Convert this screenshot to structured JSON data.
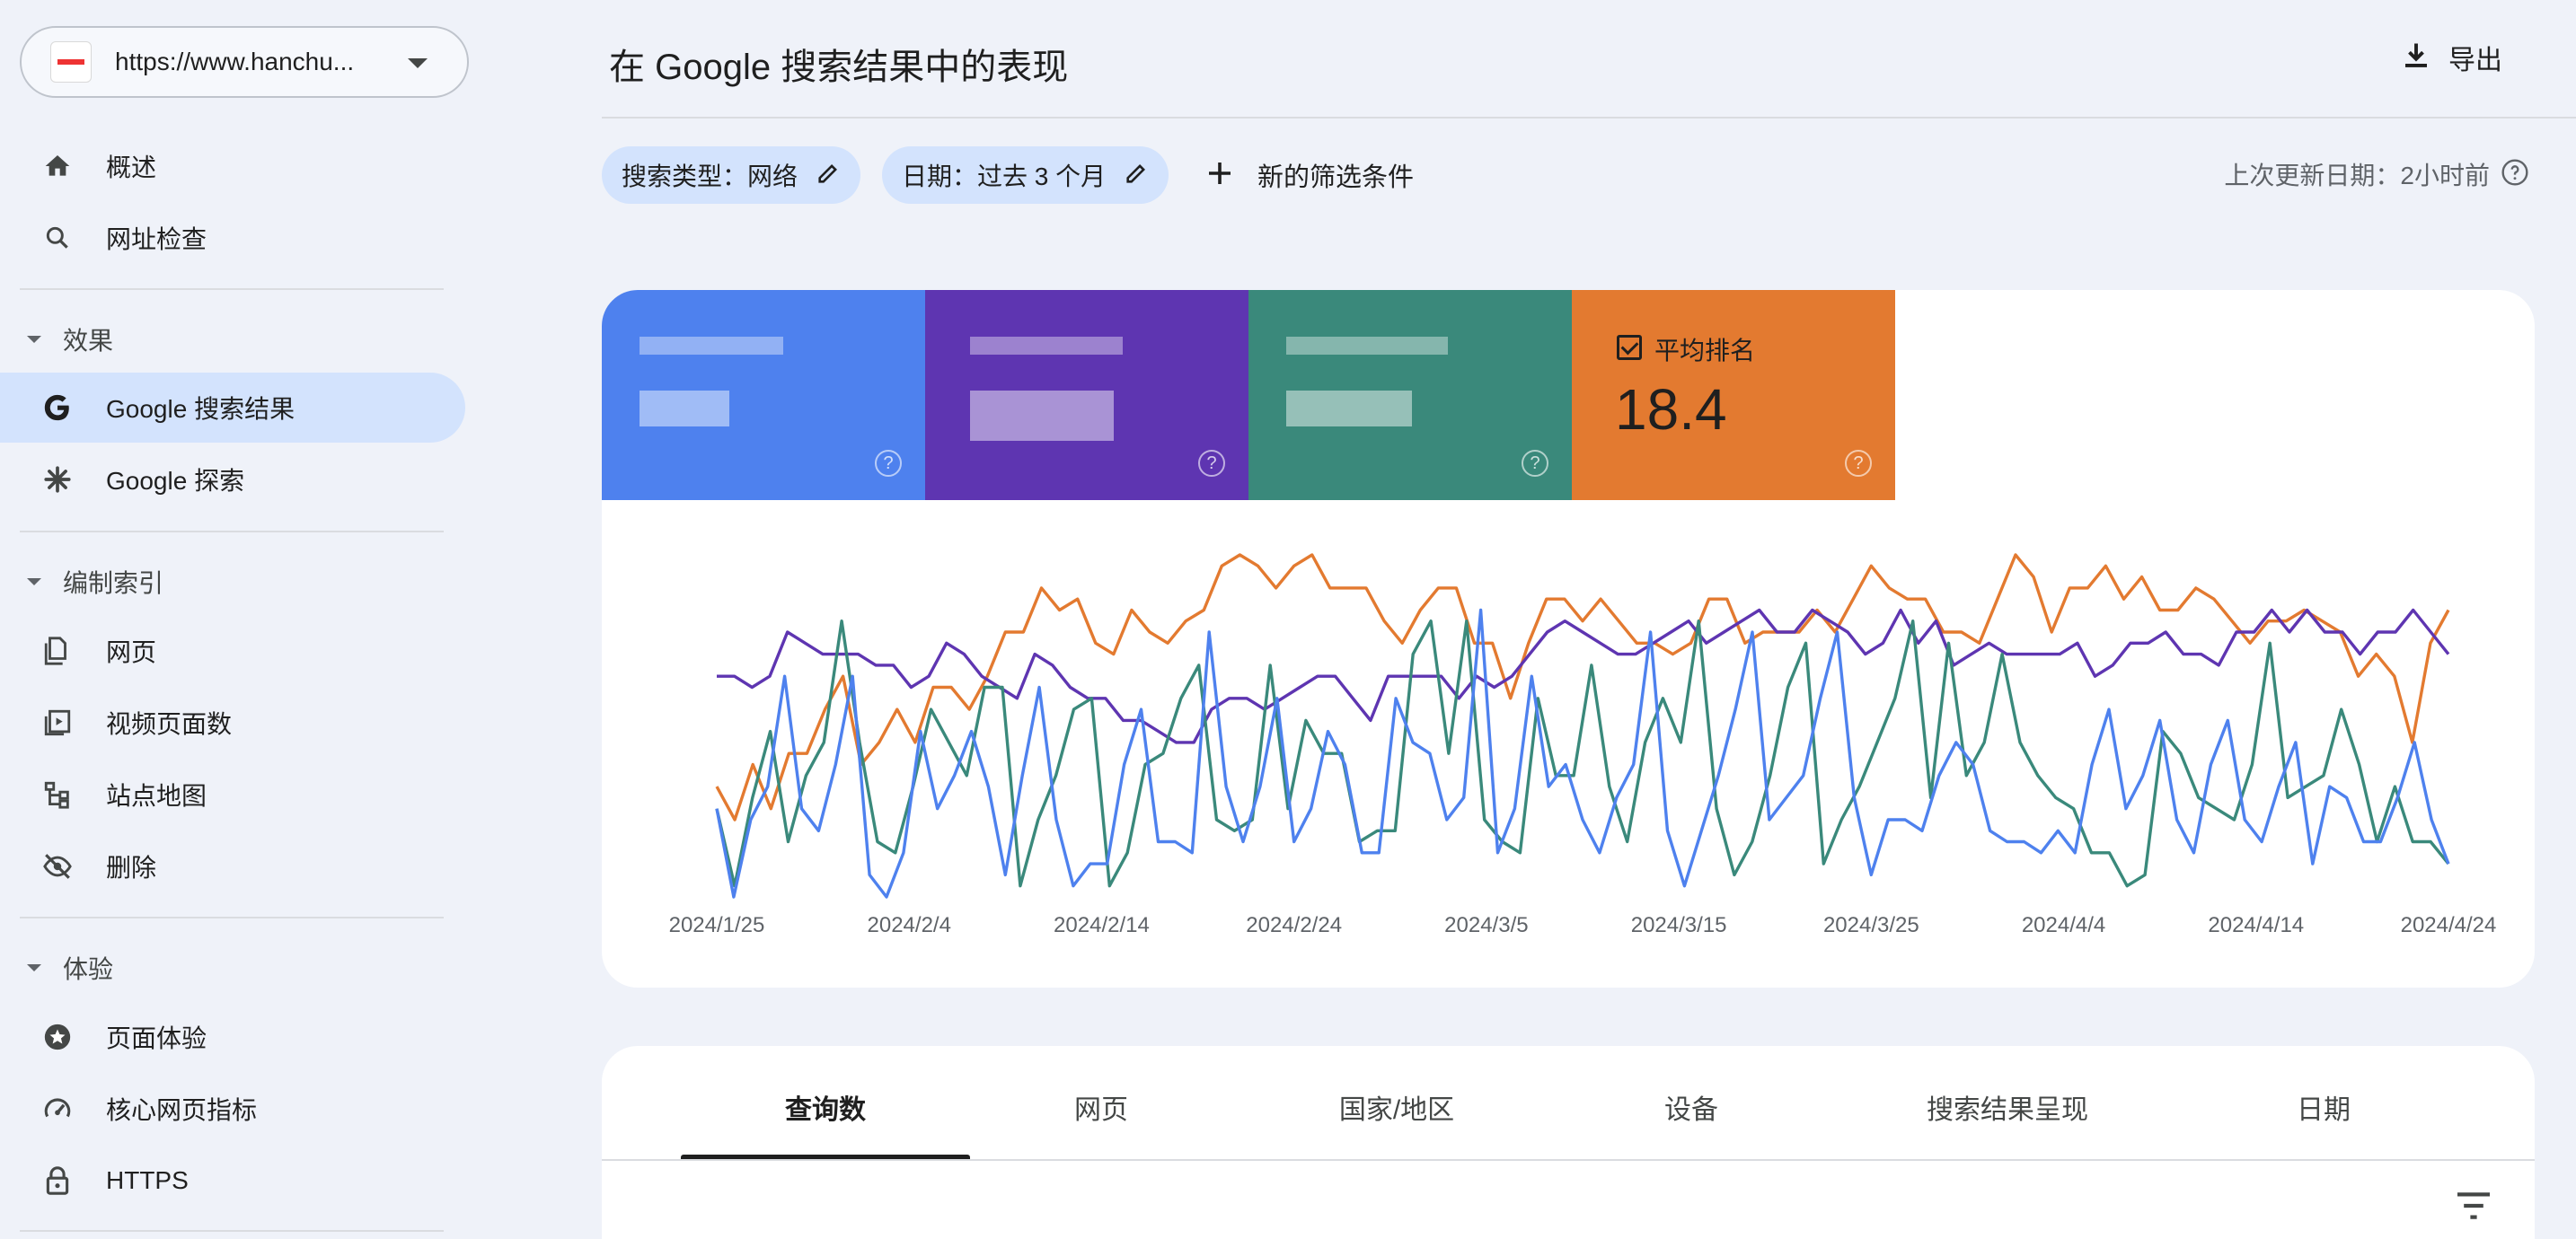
{
  "property": {
    "url": "https://www.hanchu..."
  },
  "sidebar": {
    "top_items": [
      {
        "label": "概述",
        "icon": "home-icon"
      },
      {
        "label": "网址检查",
        "icon": "search-icon"
      }
    ],
    "sections": [
      {
        "label": "效果",
        "items": [
          {
            "label": "Google 搜索结果",
            "icon": "google-g-icon",
            "active": true
          },
          {
            "label": "Google 探索",
            "icon": "asterisk-icon"
          }
        ]
      },
      {
        "label": "编制索引",
        "items": [
          {
            "label": "网页",
            "icon": "pages-icon"
          },
          {
            "label": "视频页面数",
            "icon": "video-page-icon"
          },
          {
            "label": "站点地图",
            "icon": "sitemap-icon"
          },
          {
            "label": "删除",
            "icon": "eye-off-icon"
          }
        ]
      },
      {
        "label": "体验",
        "items": [
          {
            "label": "页面体验",
            "icon": "star-badge-icon"
          },
          {
            "label": "核心网页指标",
            "icon": "gauge-icon"
          },
          {
            "label": "HTTPS",
            "icon": "lock-icon"
          }
        ]
      }
    ]
  },
  "header": {
    "title": "在 Google 搜索结果中的表现",
    "export_label": "导出"
  },
  "filters": {
    "chips": [
      {
        "label": "搜索类型：网络"
      },
      {
        "label": "日期：过去 3 个月"
      }
    ],
    "new_filter_label": "新的筛选条件",
    "last_updated": "上次更新日期：2小时前"
  },
  "metrics": [
    {
      "color": "#4e81ee",
      "obscured": true
    },
    {
      "color": "#5e35b1",
      "obscured": true
    },
    {
      "color": "#3a897b",
      "obscured": true
    },
    {
      "color": "#e37a30",
      "label": "平均排名",
      "value": "18.4",
      "checked": true
    }
  ],
  "chart_data": {
    "type": "line",
    "x_tick_labels": [
      "2024/1/25",
      "2024/2/4",
      "2024/2/14",
      "2024/2/24",
      "2024/3/5",
      "2024/3/15",
      "2024/3/25",
      "2024/4/4",
      "2024/4/14",
      "2024/4/24"
    ],
    "grid": false,
    "series": [
      {
        "color": "#e37a30",
        "values": [
          20,
          17,
          22,
          18,
          23,
          23,
          27,
          30,
          22,
          24,
          27,
          24,
          29,
          29,
          27,
          30,
          34,
          34,
          38,
          36,
          37,
          33,
          32,
          36,
          34,
          33,
          35,
          36,
          40,
          41,
          40,
          38,
          40,
          41,
          38,
          38,
          38,
          35,
          33,
          36,
          38,
          38,
          33,
          33,
          28,
          33,
          37,
          37,
          35,
          37,
          35,
          33,
          33,
          32,
          33,
          37,
          37,
          33,
          34,
          34,
          34,
          36,
          34,
          37,
          40,
          38,
          37,
          37,
          34,
          34,
          33,
          37,
          41,
          39,
          34,
          38,
          38,
          40,
          37,
          39,
          36,
          36,
          38,
          37,
          35,
          33,
          35,
          35,
          36,
          35,
          34,
          30,
          32,
          30,
          24,
          33,
          36
        ]
      },
      {
        "color": "#5e35b1",
        "values": [
          30,
          30,
          29,
          30,
          34,
          33,
          32,
          32,
          32,
          31,
          31,
          29,
          30,
          33,
          32,
          30,
          29,
          28,
          32,
          31,
          29,
          28,
          28,
          26,
          26,
          25,
          24,
          24,
          27,
          28,
          28,
          27,
          28,
          29,
          30,
          30,
          28,
          26,
          30,
          30,
          30,
          30,
          28,
          30,
          29,
          30,
          32,
          34,
          35,
          34,
          33,
          32,
          32,
          33,
          34,
          35,
          33,
          34,
          35,
          36,
          34,
          34,
          36,
          35,
          34,
          32,
          33,
          36,
          33,
          35,
          31,
          32,
          33,
          32,
          32,
          32,
          32,
          33,
          30,
          31,
          33,
          33,
          34,
          32,
          32,
          31,
          34,
          34,
          36,
          34,
          36,
          34,
          34,
          32,
          34,
          34,
          36,
          34,
          32
        ]
      },
      {
        "color": "#3a897b",
        "values": [
          18,
          11,
          19,
          25,
          15,
          21,
          24,
          35,
          24,
          15,
          14,
          20,
          27,
          24,
          21,
          29,
          29,
          11,
          17,
          21,
          27,
          28,
          11,
          14,
          22,
          23,
          28,
          31,
          17,
          16,
          17,
          31,
          18,
          26,
          23,
          23,
          15,
          16,
          16,
          32,
          35,
          23,
          35,
          17,
          15,
          14,
          28,
          21,
          21,
          31,
          20,
          15,
          24,
          28,
          24,
          35,
          18,
          12,
          15,
          21,
          29,
          33,
          13,
          17,
          20,
          24,
          28,
          35,
          19,
          33,
          21,
          24,
          32,
          24,
          21,
          19,
          18,
          14,
          14,
          11,
          12,
          25,
          23,
          19,
          18,
          17,
          22,
          33,
          19,
          20,
          21,
          27,
          22,
          15,
          20,
          15,
          15,
          13
        ]
      },
      {
        "color": "#4e81ee",
        "values": [
          18,
          10,
          17,
          20,
          30,
          18,
          16,
          22,
          30,
          12,
          10,
          14,
          25,
          18,
          21,
          25,
          20,
          12,
          21,
          29,
          17,
          11,
          13,
          13,
          22,
          27,
          15,
          15,
          14,
          34,
          20,
          15,
          20,
          28,
          15,
          18,
          25,
          22,
          14,
          14,
          28,
          24,
          23,
          17,
          19,
          36,
          14,
          18,
          30,
          20,
          22,
          17,
          14,
          19,
          22,
          34,
          16,
          11,
          16,
          21,
          27,
          34,
          17,
          19,
          21,
          28,
          34,
          19,
          12,
          17,
          17,
          16,
          21,
          24,
          22,
          16,
          15,
          15,
          14,
          16,
          14,
          22,
          27,
          18,
          21,
          26,
          17,
          14,
          22,
          26,
          17,
          15,
          20,
          24,
          13,
          20,
          19,
          15,
          15,
          19,
          24,
          17,
          13
        ]
      }
    ]
  },
  "tabs": [
    "查询数",
    "网页",
    "国家/地区",
    "设备",
    "搜索结果呈现",
    "日期"
  ]
}
